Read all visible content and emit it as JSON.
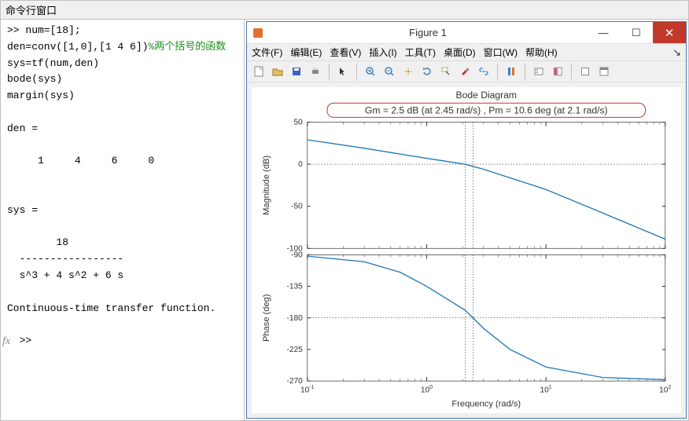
{
  "outer_title": "命令行窗口",
  "console": {
    "line1_prefix": ">> num=[18];",
    "line2_code": "den=conv([1,0],[1 4 6])",
    "line2_comment": "%两个括号的函数",
    "line3": "sys=tf(num,den)",
    "line4": "bode(sys)",
    "line5": "margin(sys)",
    "blank": "",
    "den_label": "den =",
    "den_values": "     1     4     6     0",
    "sys_label": "sys =",
    "tf_num": "        18",
    "tf_div": "  -----------------",
    "tf_den": "  s^3 + 4 s^2 + 6 s",
    "tf_desc": "Continuous-time transfer function.",
    "prompt": ">>",
    "fx": "fx"
  },
  "figure": {
    "title": "Figure 1",
    "menus": {
      "file": "文件(F)",
      "edit": "编辑(E)",
      "view": "查看(V)",
      "insert": "插入(I)",
      "tools": "工具(T)",
      "desktop": "桌面(D)",
      "window": "窗口(W)",
      "help": "帮助(H)"
    },
    "toolbar_icons": [
      "new-figure-icon",
      "open-icon",
      "save-icon",
      "print-icon",
      "pointer-icon",
      "zoom-in-icon",
      "zoom-out-icon",
      "pan-icon",
      "rotate-icon",
      "data-cursor-icon",
      "brush-icon",
      "link-icon",
      "colorbar-icon",
      "legend-icon",
      "hide-plot-tools-icon",
      "show-plot-tools-icon"
    ]
  },
  "chart_data": {
    "type": "line",
    "title": "Bode Diagram",
    "annotation": "Gm = 2.5 dB (at 2.45 rad/s) ,  Pm = 10.6 deg (at 2.1 rad/s)",
    "xlabel": "Frequency  (rad/s)",
    "xlim": [
      0.1,
      100
    ],
    "xscale": "log",
    "subplots": [
      {
        "ylabel": "Magnitude (dB)",
        "ylim": [
          -100,
          50
        ],
        "yticks": [
          -100,
          -50,
          0,
          50
        ],
        "series": [
          {
            "name": "mag",
            "x": [
              0.1,
              0.3,
              1,
              2.1,
              3,
              10,
              30,
              100
            ],
            "y": [
              29,
              19,
              7,
              0,
              -6,
              -30,
              -58,
              -89
            ]
          }
        ],
        "crossings_x": [
          2.1,
          2.45
        ]
      },
      {
        "ylabel": "Phase (deg)",
        "ylim": [
          -270,
          -90
        ],
        "yticks": [
          -270,
          -225,
          -180,
          -135,
          -90
        ],
        "series": [
          {
            "name": "phase",
            "x": [
              0.1,
              0.3,
              0.6,
              1,
              2.1,
              2.45,
              3,
              5,
              10,
              30,
              100
            ],
            "y": [
              -92,
              -100,
              -115,
              -135,
              -169,
              -180,
              -195,
              -225,
              -250,
              -265,
              -268
            ]
          }
        ],
        "crossings_x": [
          2.1,
          2.45
        ]
      }
    ]
  }
}
